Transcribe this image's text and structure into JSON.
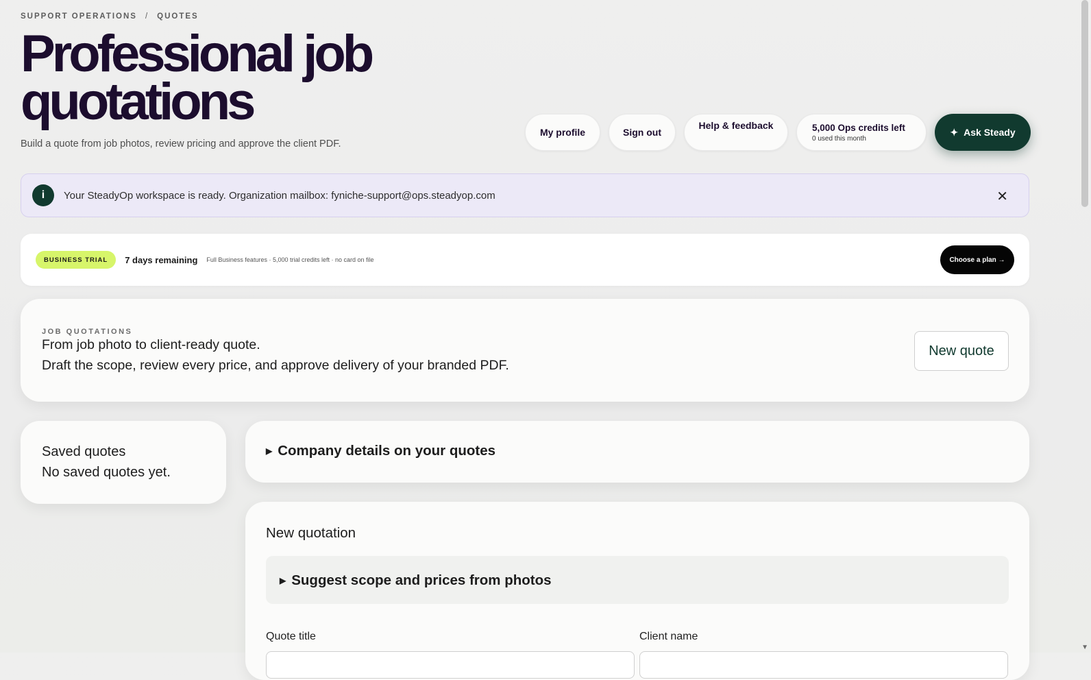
{
  "breadcrumb": {
    "section": "SUPPORT OPERATIONS",
    "separator": "/",
    "page": "QUOTES"
  },
  "header": {
    "title": "Professional job quotations",
    "subtitle": "Build a quote from job photos, review pricing and approve the client PDF."
  },
  "nav": {
    "my_profile": "My profile",
    "sign_out": "Sign out",
    "help": "Help & feedback",
    "credits_main": "5,000 Ops credits left",
    "credits_sub": "0 used this month",
    "ask_icon": "✦",
    "ask_label": "Ask Steady"
  },
  "banner": {
    "icon": "i",
    "text": "Your SteadyOp workspace is ready. Organization mailbox: fyniche-support@ops.steadyop.com",
    "close": "✕"
  },
  "trial": {
    "badge": "BUSINESS TRIAL",
    "days": "7 days remaining",
    "note": "Full Business features · 5,000 trial credits left · no card on file",
    "cta": "Choose a plan →"
  },
  "job_quotations": {
    "eyebrow": "JOB QUOTATIONS",
    "line1": "From job photo to client-ready quote.",
    "line2": "Draft the scope, review every price, and approve delivery of your branded PDF.",
    "new_quote": "New quote"
  },
  "saved_quotes": {
    "title": "Saved quotes",
    "empty": "No saved quotes yet."
  },
  "company_details": {
    "summary": "Company details on your quotes"
  },
  "new_quotation": {
    "title": "New quotation",
    "suggest": "Suggest scope and prices from photos",
    "quote_title_label": "Quote title",
    "client_name_label": "Client name",
    "quote_title_value": "",
    "client_name_value": ""
  },
  "colors": {
    "accent": "#113a2f",
    "trial_badge": "#d7f56a",
    "banner_bg": "#ece9f7"
  }
}
